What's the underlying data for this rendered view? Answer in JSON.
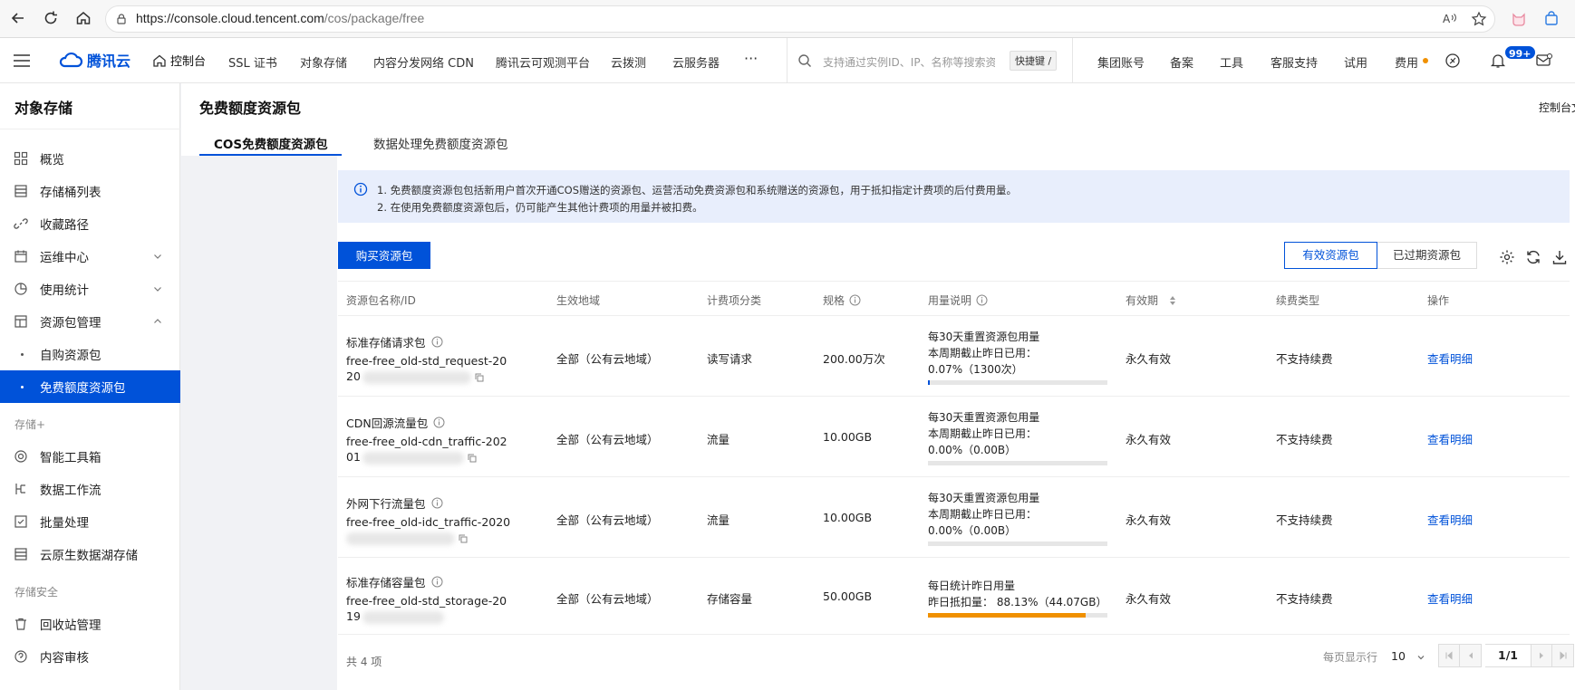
{
  "browser": {
    "url_prefix": "https://console.cloud.tencent.com",
    "url_path": "/cos/package/free"
  },
  "topnav": {
    "logo_text": "腾讯云",
    "console": "控制台",
    "items": [
      "SSL 证书",
      "对象存储",
      "内容分发网络 CDN",
      "腾讯云可观测平台",
      "云拨测",
      "云服务器"
    ],
    "more": "···",
    "search_placeholder": "支持通过实例ID、IP、名称等搜索资源",
    "shortcut": "快捷键 /",
    "right_items": [
      "集团账号",
      "备案",
      "工具",
      "客服支持",
      "试用",
      "费用"
    ],
    "notification_badge": "99+"
  },
  "sidebar": {
    "title": "对象存储",
    "items": [
      {
        "label": "概览"
      },
      {
        "label": "存储桶列表"
      },
      {
        "label": "收藏路径"
      },
      {
        "label": "运维中心"
      },
      {
        "label": "使用统计"
      },
      {
        "label": "资源包管理"
      },
      {
        "label": "自购资源包"
      },
      {
        "label": "免费额度资源包"
      }
    ],
    "group_storage_plus": "存储+",
    "storage_plus_items": [
      {
        "label": "智能工具箱"
      },
      {
        "label": "数据工作流"
      },
      {
        "label": "批量处理"
      },
      {
        "label": "云原生数据湖存储"
      }
    ],
    "group_security": "存储安全",
    "security_items": [
      {
        "label": "回收站管理"
      },
      {
        "label": "内容审核"
      }
    ]
  },
  "page": {
    "title": "免费额度资源包",
    "console_link": "控制台文",
    "tabs": [
      "COS免费额度资源包",
      "数据处理免费额度资源包"
    ]
  },
  "notice": {
    "line1": "1. 免费额度资源包包括新用户首次开通COS赠送的资源包、运营活动免费资源包和系统赠送的资源包，用于抵扣指定计费项的后付费用量。",
    "line2": "2. 在使用免费额度资源包后，仍可能产生其他计费项的用量并被扣费。"
  },
  "toolbar": {
    "buy_button": "购买资源包",
    "valid_tab": "有效资源包",
    "expired_tab": "已过期资源包"
  },
  "table": {
    "headers": [
      "资源包名称/ID",
      "生效地域",
      "计费项分类",
      "规格",
      "用量说明",
      "有效期",
      "续费类型",
      "操作"
    ],
    "rows": [
      {
        "name": "标准存储请求包",
        "id_line1": "free-free_old-std_request-20",
        "id_line2": "20",
        "region": "全部（公有云地域）",
        "category": "读写请求",
        "spec": "200.00万次",
        "usage_title": "每30天重置资源包用量",
        "usage_sub": "本周期截止昨日已用：",
        "usage_value": "0.07%（1300次）",
        "usage_pct": 0.07,
        "validity": "永久有效",
        "renewal": "不支持续费",
        "action": "查看明细"
      },
      {
        "name": "CDN回源流量包",
        "id_line1": "free-free_old-cdn_traffic-202",
        "id_line2": "01",
        "region": "全部（公有云地域）",
        "category": "流量",
        "spec": "10.00GB",
        "usage_title": "每30天重置资源包用量",
        "usage_sub": "本周期截止昨日已用：",
        "usage_value": "0.00%（0.00B）",
        "usage_pct": 0,
        "validity": "永久有效",
        "renewal": "不支持续费",
        "action": "查看明细"
      },
      {
        "name": "外网下行流量包",
        "id_line1": "free-free_old-idc_traffic-2020",
        "id_line2": "",
        "region": "全部（公有云地域）",
        "category": "流量",
        "spec": "10.00GB",
        "usage_title": "每30天重置资源包用量",
        "usage_sub": "本周期截止昨日已用：",
        "usage_value": "0.00%（0.00B）",
        "usage_pct": 0,
        "validity": "永久有效",
        "renewal": "不支持续费",
        "action": "查看明细"
      },
      {
        "name": "标准存储容量包",
        "id_line1": "free-free_old-std_storage-20",
        "id_line2": "19",
        "region": "全部（公有云地域）",
        "category": "存储容量",
        "spec": "50.00GB",
        "usage_title": "每日统计昨日用量",
        "usage_sub": "",
        "usage_value": "昨日抵扣量： 88.13%（44.07GB）",
        "usage_pct": 88.13,
        "validity": "永久有效",
        "renewal": "不支持续费",
        "action": "查看明细"
      }
    ]
  },
  "pagination": {
    "total": "共 4 项",
    "per_page_label": "每页显示行",
    "per_page": "10",
    "page": "1/1"
  },
  "colors": {
    "primary": "#0052d9",
    "warning": "#f09000",
    "notice_bg": "#e8eefc"
  }
}
